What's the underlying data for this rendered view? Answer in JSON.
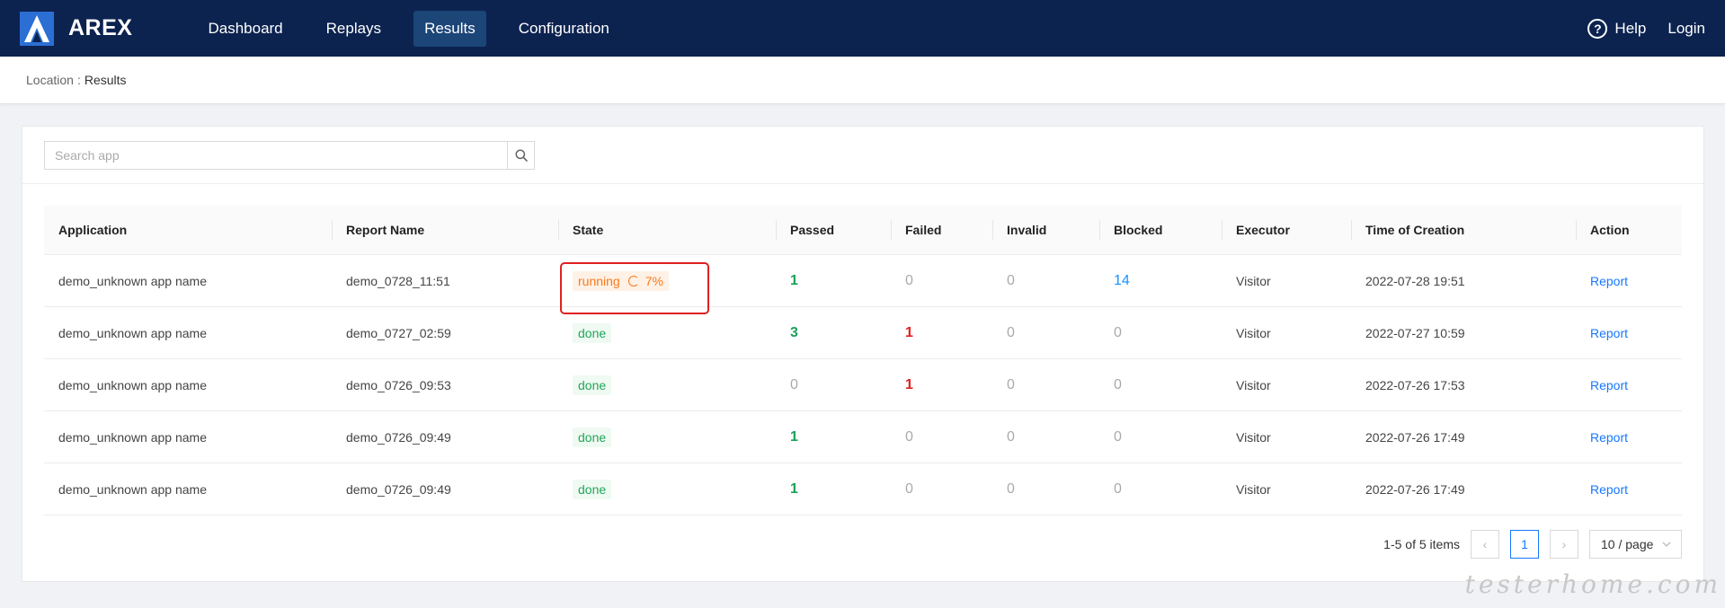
{
  "header": {
    "brand": "AREX",
    "nav": [
      {
        "label": "Dashboard",
        "active": false
      },
      {
        "label": "Replays",
        "active": false
      },
      {
        "label": "Results",
        "active": true
      },
      {
        "label": "Configuration",
        "active": false
      }
    ],
    "help": "Help",
    "login": "Login"
  },
  "breadcrumb": {
    "label": "Location",
    "separator": ":",
    "current": "Results"
  },
  "search": {
    "placeholder": "Search app",
    "value": ""
  },
  "table": {
    "columns": [
      "Application",
      "Report Name",
      "State",
      "Passed",
      "Failed",
      "Invalid",
      "Blocked",
      "Executor",
      "Time of Creation",
      "Action"
    ],
    "rows": [
      {
        "application": "demo_unknown app name",
        "report": "demo_0728_11:51",
        "state": "running",
        "progress": "7%",
        "passed": "1",
        "failed": "0",
        "invalid": "0",
        "blocked": "14",
        "executor": "Visitor",
        "time": "2022-07-28 19:51",
        "action": "Report"
      },
      {
        "application": "demo_unknown app name",
        "report": "demo_0727_02:59",
        "state": "done",
        "passed": "3",
        "failed": "1",
        "invalid": "0",
        "blocked": "0",
        "executor": "Visitor",
        "time": "2022-07-27 10:59",
        "action": "Report"
      },
      {
        "application": "demo_unknown app name",
        "report": "demo_0726_09:53",
        "state": "done",
        "passed": "0",
        "failed": "1",
        "invalid": "0",
        "blocked": "0",
        "executor": "Visitor",
        "time": "2022-07-26 17:53",
        "action": "Report"
      },
      {
        "application": "demo_unknown app name",
        "report": "demo_0726_09:49",
        "state": "done",
        "passed": "1",
        "failed": "0",
        "invalid": "0",
        "blocked": "0",
        "executor": "Visitor",
        "time": "2022-07-26 17:49",
        "action": "Report"
      },
      {
        "application": "demo_unknown app name",
        "report": "demo_0726_09:49",
        "state": "done",
        "passed": "1",
        "failed": "0",
        "invalid": "0",
        "blocked": "0",
        "executor": "Visitor",
        "time": "2022-07-26 17:49",
        "action": "Report"
      }
    ]
  },
  "pagination": {
    "total": "1-5 of 5 items",
    "current_page": "1",
    "page_size": "10 / page"
  },
  "watermark": "testerhome.com",
  "colors": {
    "topbar": "#0c2350",
    "nav_active": "#1c4578",
    "running": "#fa7a1a",
    "done": "#22a55a",
    "passed": "#1aa05a",
    "failed": "#e02020",
    "blocked": "#1890ff",
    "link": "#1677ff"
  }
}
